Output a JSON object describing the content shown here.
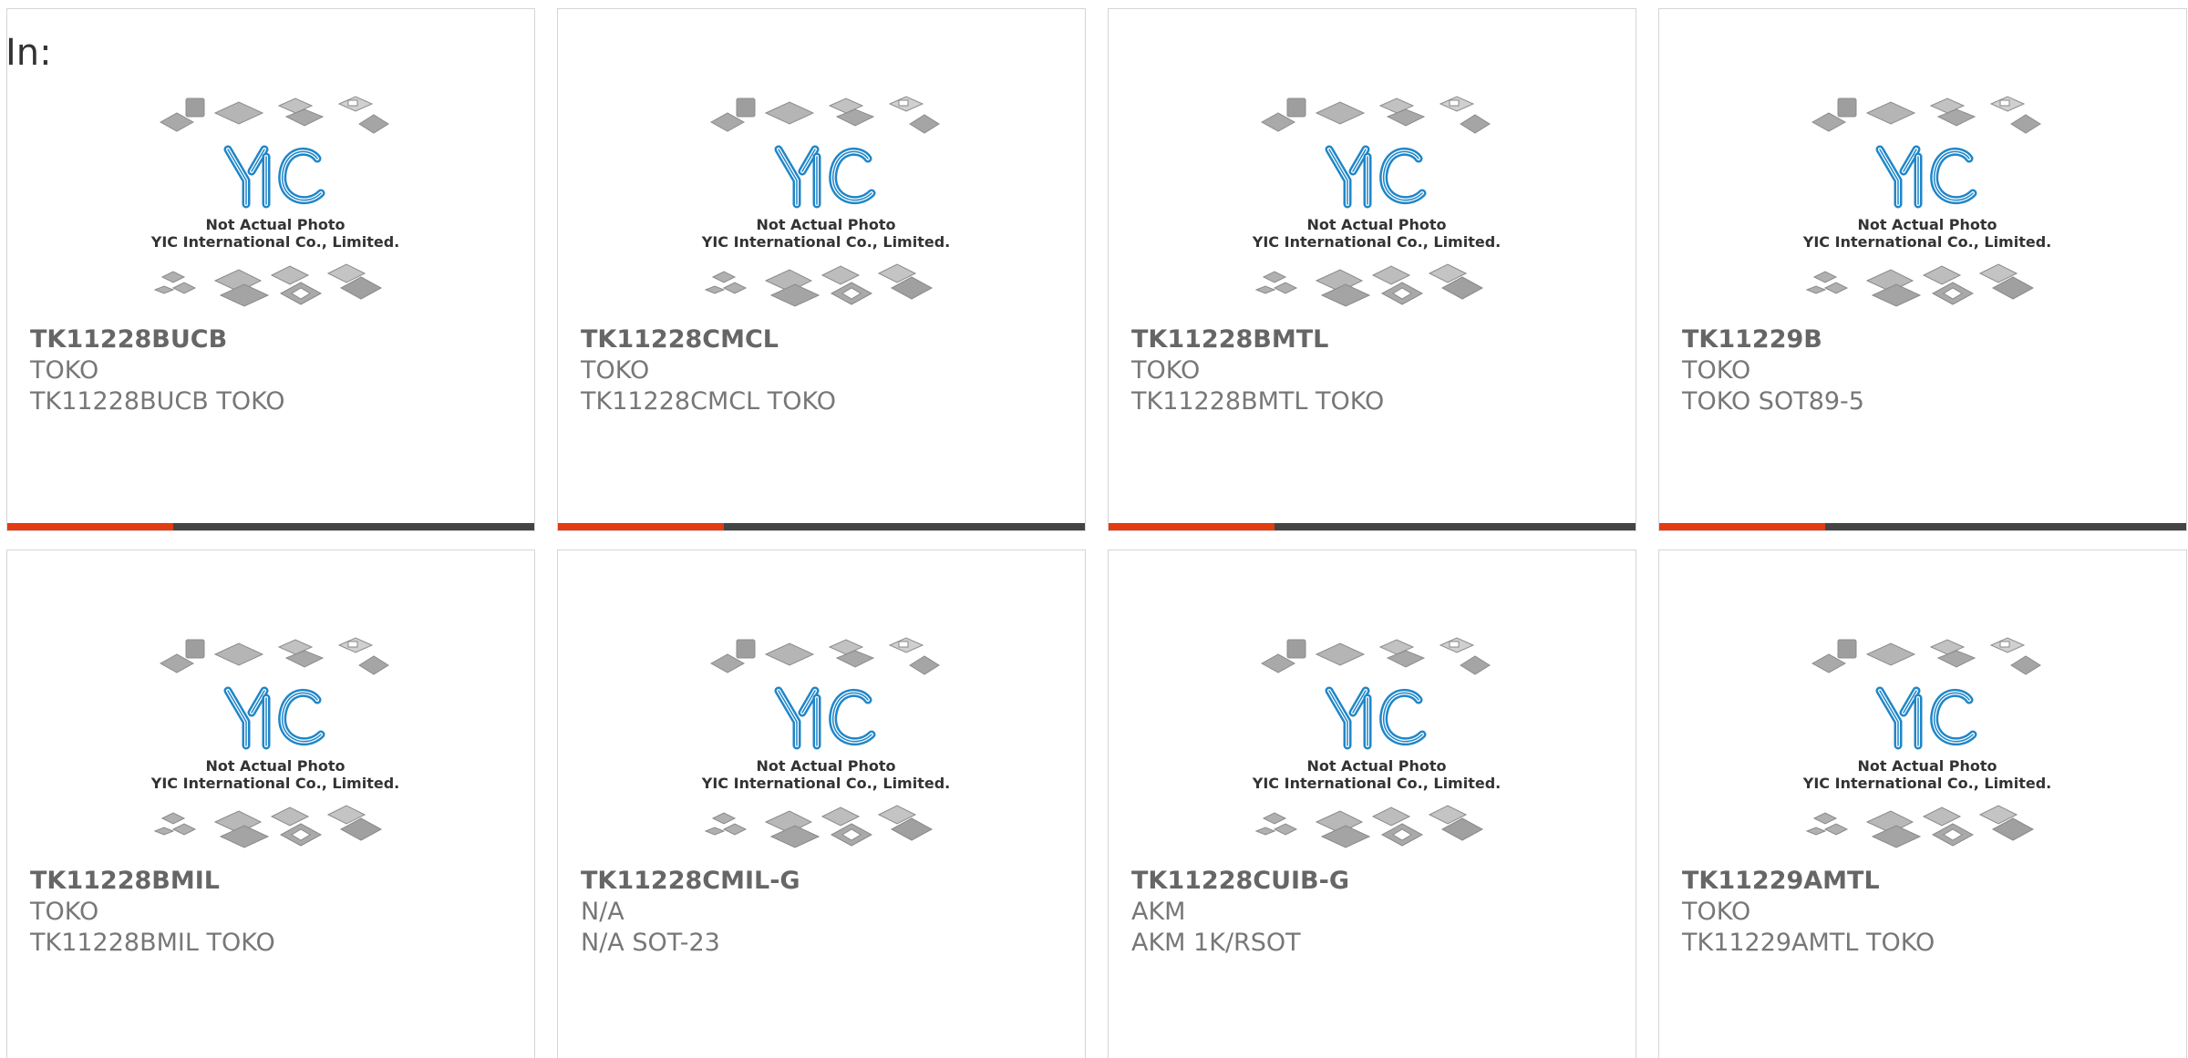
{
  "header": {
    "label": "In:"
  },
  "thumbnail": {
    "caption_line1": "Not Actual Photo",
    "caption_line2": "YIC International Co., Limited.",
    "logo_text": "YIC",
    "logo_color": "#1f86c8"
  },
  "colors": {
    "accent_bar": "#e33b12",
    "bar_dark": "#444444"
  },
  "products": [
    {
      "part_number": "TK11228BUCB",
      "manufacturer": "TOKO",
      "description": "TK11228BUCB TOKO",
      "has_bar": true
    },
    {
      "part_number": "TK11228CMCL",
      "manufacturer": "TOKO",
      "description": "TK11228CMCL TOKO",
      "has_bar": true
    },
    {
      "part_number": "TK11228BMTL",
      "manufacturer": "TOKO",
      "description": "TK11228BMTL TOKO",
      "has_bar": true
    },
    {
      "part_number": "TK11229B",
      "manufacturer": "TOKO",
      "description": "TOKO SOT89-5",
      "has_bar": true
    },
    {
      "part_number": "TK11228BMIL",
      "manufacturer": "TOKO",
      "description": "TK11228BMIL TOKO",
      "has_bar": false
    },
    {
      "part_number": "TK11228CMIL-G",
      "manufacturer": "N/A",
      "description": "N/A SOT-23",
      "has_bar": false
    },
    {
      "part_number": "TK11228CUIB-G",
      "manufacturer": "AKM",
      "description": "AKM 1K/RSOT",
      "has_bar": false
    },
    {
      "part_number": "TK11229AMTL",
      "manufacturer": "TOKO",
      "description": "TK11229AMTL TOKO",
      "has_bar": false
    }
  ]
}
